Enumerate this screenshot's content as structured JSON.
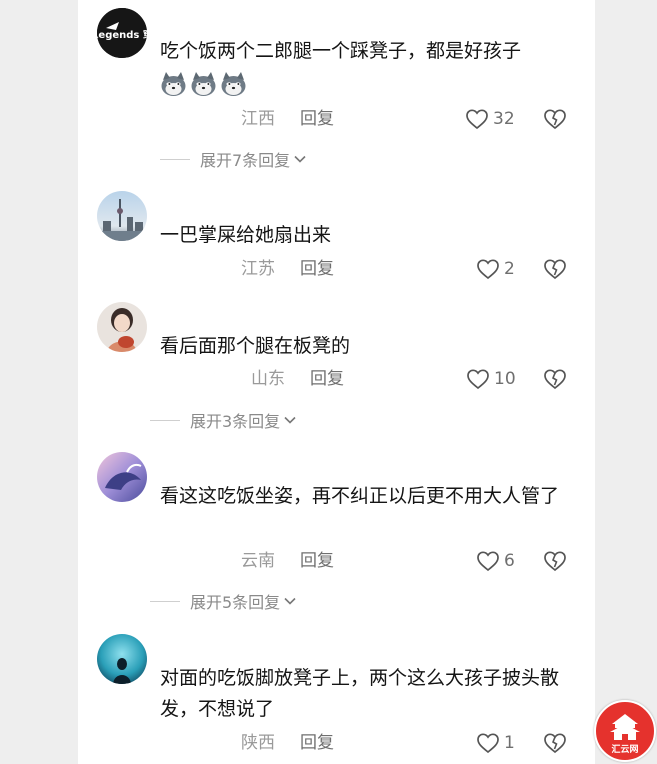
{
  "comments": [
    {
      "text": "吃个饭两个二郎腿一个踩凳子，都是好孩子",
      "emoji_icon": "husky-face-icon",
      "emoji_count": 3,
      "location": "江西",
      "reply_label": "回复",
      "likes": "32",
      "expand_label": "展开7条回复",
      "avatar_text": "Time Legends 穿越时代"
    },
    {
      "text": "一巴掌屎给她扇出来",
      "location": "江苏",
      "reply_label": "回复",
      "likes": "2",
      "avatar_icon": "city-skyline-avatar"
    },
    {
      "text": "看后面那个腿在板凳的",
      "location": "山东",
      "reply_label": "回复",
      "likes": "10",
      "expand_label": "展开3条回复",
      "avatar_icon": "girl-portrait-avatar"
    },
    {
      "text": "看这这吃饭坐姿，再不纠正以后更不用大人管了",
      "location": "云南",
      "reply_label": "回复",
      "likes": "6",
      "expand_label": "展开5条回复",
      "avatar_icon": "purple-whale-avatar"
    },
    {
      "text": "对面的吃饭脚放凳子上，两个这么大孩子披头散发，不想说了",
      "location": "陕西",
      "reply_label": "回复",
      "likes": "1",
      "avatar_icon": "aquarium-silhouette-avatar"
    }
  ],
  "colors": {
    "text": "#151515",
    "meta": "#9a9a9a",
    "watermark": "#e5322d"
  },
  "watermark": {
    "text": "汇云网"
  }
}
